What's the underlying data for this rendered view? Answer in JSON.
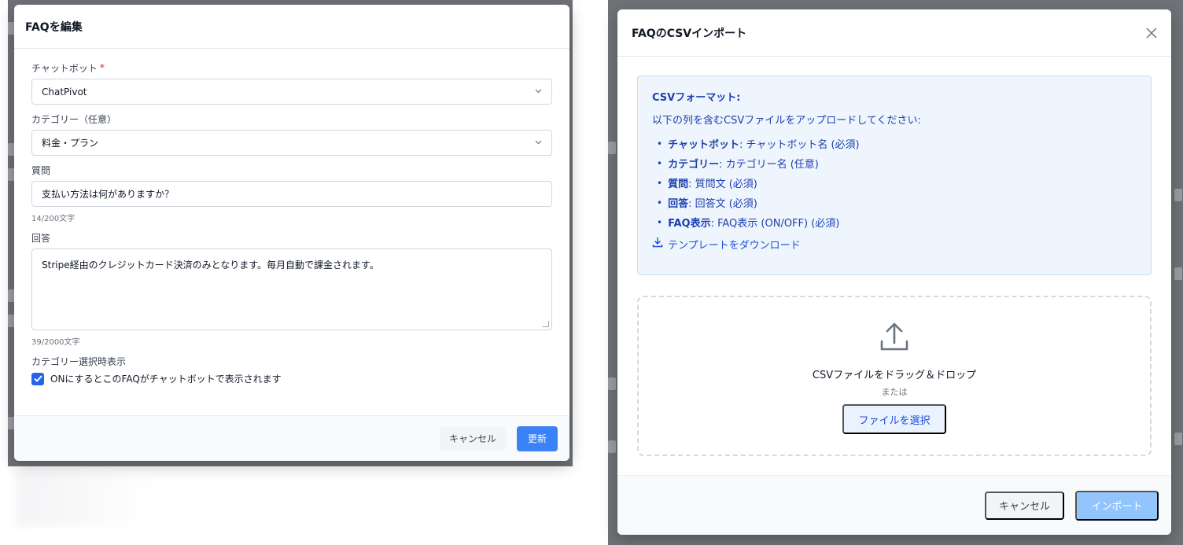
{
  "edit_modal": {
    "title": "FAQを編集",
    "chatbot": {
      "label": "チャットボット",
      "required_mark": "*",
      "value": "ChatPivot"
    },
    "category": {
      "label": "カテゴリー（任意）",
      "value": "料金・プラン"
    },
    "question": {
      "label": "質問",
      "value": "支払い方法は何がありますか？",
      "counter": "14/200文字"
    },
    "answer": {
      "label": "回答",
      "value": "Stripe経由のクレジットカード決済のみとなります。毎月自動で課金されます。",
      "counter": "39/2000文字"
    },
    "display": {
      "label": "カテゴリー選択時表示",
      "checkbox_text": "ONにするとこのFAQがチャットボットで表示されます",
      "checked": true
    },
    "cancel_label": "キャンセル",
    "submit_label": "更新"
  },
  "import_modal": {
    "title": "FAQのCSVインポート",
    "format_title": "CSVフォーマット:",
    "format_desc": "以下の列を含むCSVファイルをアップロードしてください:",
    "columns": [
      {
        "name": "チャットボット",
        "desc": ": チャットボット名 (必須)"
      },
      {
        "name": "カテゴリー",
        "desc": ": カテゴリー名 (任意)"
      },
      {
        "name": "質問",
        "desc": ": 質問文 (必須)"
      },
      {
        "name": "回答",
        "desc": ": 回答文 (必須)"
      },
      {
        "name": "FAQ表示",
        "desc": ": FAQ表示 (ON/OFF) (必須)"
      }
    ],
    "download_label": "テンプレートをダウンロード",
    "dropzone_text": "CSVファイルをドラッグ＆ドロップ",
    "or_text": "または",
    "select_file_label": "ファイルを選択",
    "cancel_label": "キャンセル",
    "import_label": "インポート"
  },
  "colors": {
    "primary": "#3b82f6",
    "primary_disabled": "#93c5fd",
    "info_bg": "#eef5fd",
    "info_text": "#1e40af",
    "required": "#dc2626"
  }
}
